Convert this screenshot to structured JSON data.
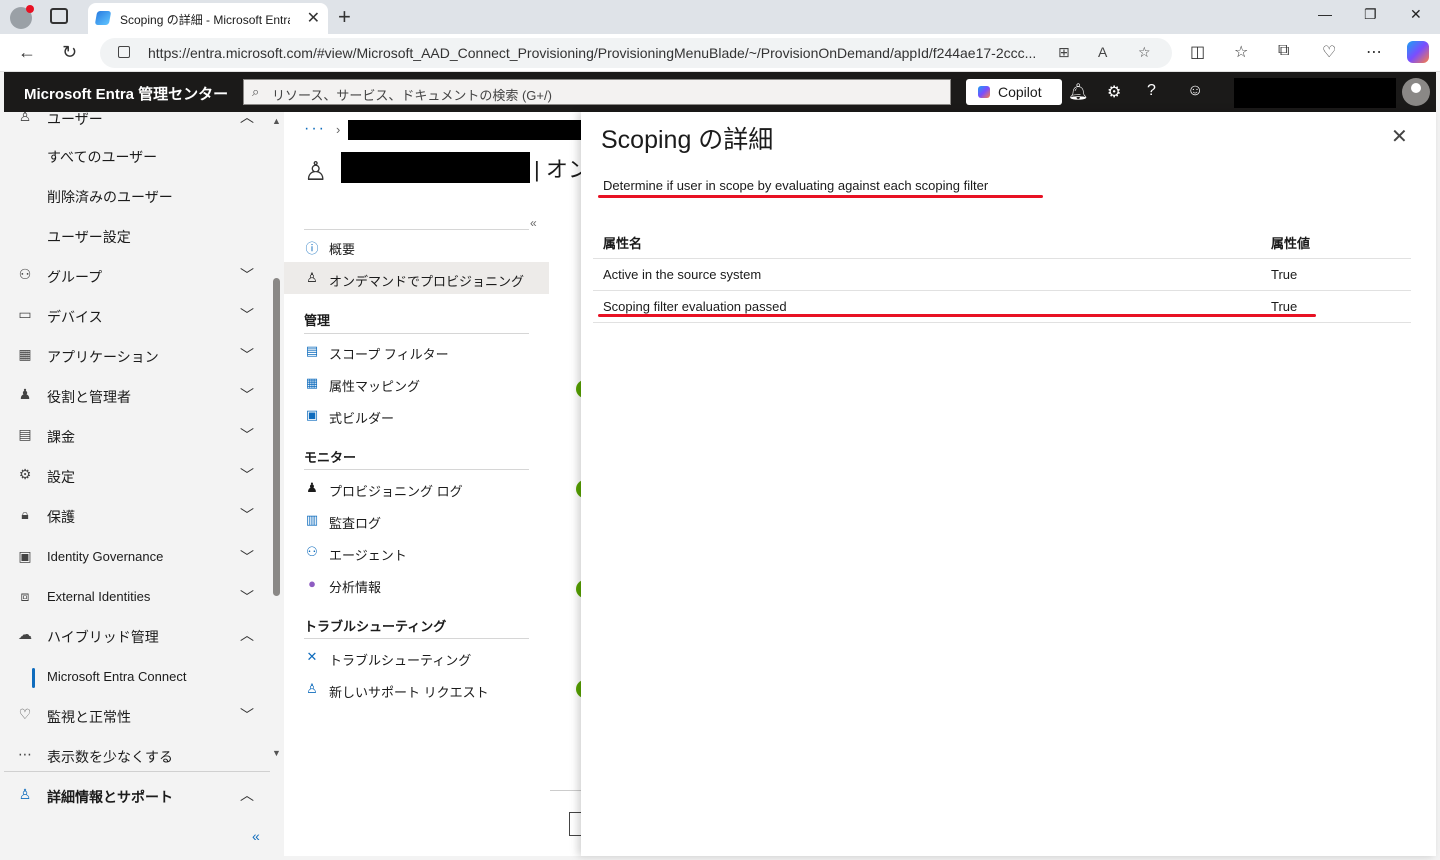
{
  "browser": {
    "tab_title": "Scoping の詳細 - Microsoft Entra",
    "url": "https://entra.microsoft.com/#view/Microsoft_AAD_Connect_Provisioning/ProvisioningMenuBlade/~/ProvisionOnDemand/appId/f244ae17-2ccc...",
    "icons": [
      "back-icon",
      "refresh-icon",
      "lock-icon",
      "app-available-icon",
      "read-aloud-icon",
      "favorite-icon",
      "split-screen-icon",
      "favorites-icon",
      "collections-icon",
      "browser-essentials-icon",
      "more-icon",
      "copilot-icon"
    ]
  },
  "header": {
    "brand": "Microsoft Entra 管理センター",
    "search_placeholder": "リソース、サービス、ドキュメントの検索 (G+/)",
    "copilot_label": "Copilot"
  },
  "leftnav": {
    "items": [
      {
        "label": "ユーザー",
        "icon": "user-icon",
        "expanded": true
      },
      {
        "label": "すべてのユーザー",
        "sub": true
      },
      {
        "label": "削除済みのユーザー",
        "sub": true
      },
      {
        "label": "ユーザー設定",
        "sub": true
      },
      {
        "label": "グループ",
        "icon": "group-icon"
      },
      {
        "label": "デバイス",
        "icon": "device-icon"
      },
      {
        "label": "アプリケーション",
        "icon": "apps-icon"
      },
      {
        "label": "役割と管理者",
        "icon": "roles-icon"
      },
      {
        "label": "課金",
        "icon": "billing-icon"
      },
      {
        "label": "設定",
        "icon": "settings-icon"
      },
      {
        "label": "保護",
        "icon": "lock-icon"
      },
      {
        "label": "Identity Governance",
        "icon": "governance-icon"
      },
      {
        "label": "External Identities",
        "icon": "external-icon"
      },
      {
        "label": "ハイブリッド管理",
        "icon": "cloud-icon",
        "expanded": true
      },
      {
        "label": "Microsoft Entra Connect",
        "sub": true,
        "active": true
      },
      {
        "label": "監視と正常性",
        "icon": "heart-monitor-icon"
      },
      {
        "label": "表示数を少なくする",
        "icon": "ellipsis-icon"
      },
      {
        "label": "詳細情報とサポート",
        "icon": "support-icon",
        "expanded": true
      }
    ]
  },
  "blade": {
    "title_fragment": "| オン",
    "menu": {
      "top": [
        {
          "label": "概要",
          "icon": "info-icon"
        },
        {
          "label": "オンデマンドでプロビジョニング",
          "icon": "provision-user-icon",
          "selected": true
        }
      ],
      "sections": [
        {
          "title": "管理",
          "items": [
            {
              "label": "スコープ フィルター",
              "icon": "scope-filter-icon"
            },
            {
              "label": "属性マッピング",
              "icon": "attribute-mapping-icon"
            },
            {
              "label": "式ビルダー",
              "icon": "expression-builder-icon"
            }
          ]
        },
        {
          "title": "モニター",
          "items": [
            {
              "label": "プロビジョニング ログ",
              "icon": "provisioning-log-icon"
            },
            {
              "label": "監査ログ",
              "icon": "audit-log-icon"
            },
            {
              "label": "エージェント",
              "icon": "agent-icon"
            },
            {
              "label": "分析情報",
              "icon": "insights-icon"
            }
          ]
        },
        {
          "title": "トラブルシューティング",
          "items": [
            {
              "label": "トラブルシューティング",
              "icon": "troubleshoot-icon"
            },
            {
              "label": "新しいサポート リクエスト",
              "icon": "support-request-icon"
            }
          ]
        }
      ]
    }
  },
  "panel": {
    "title": "Scoping の詳細",
    "description": "Determine if user in scope by evaluating against each scoping filter",
    "columns": [
      "属性名",
      "属性値"
    ],
    "rows": [
      [
        "Active in the source system",
        "True"
      ],
      [
        "Scoping filter evaluation passed",
        "True"
      ]
    ],
    "highlight_color": "#e81123"
  }
}
